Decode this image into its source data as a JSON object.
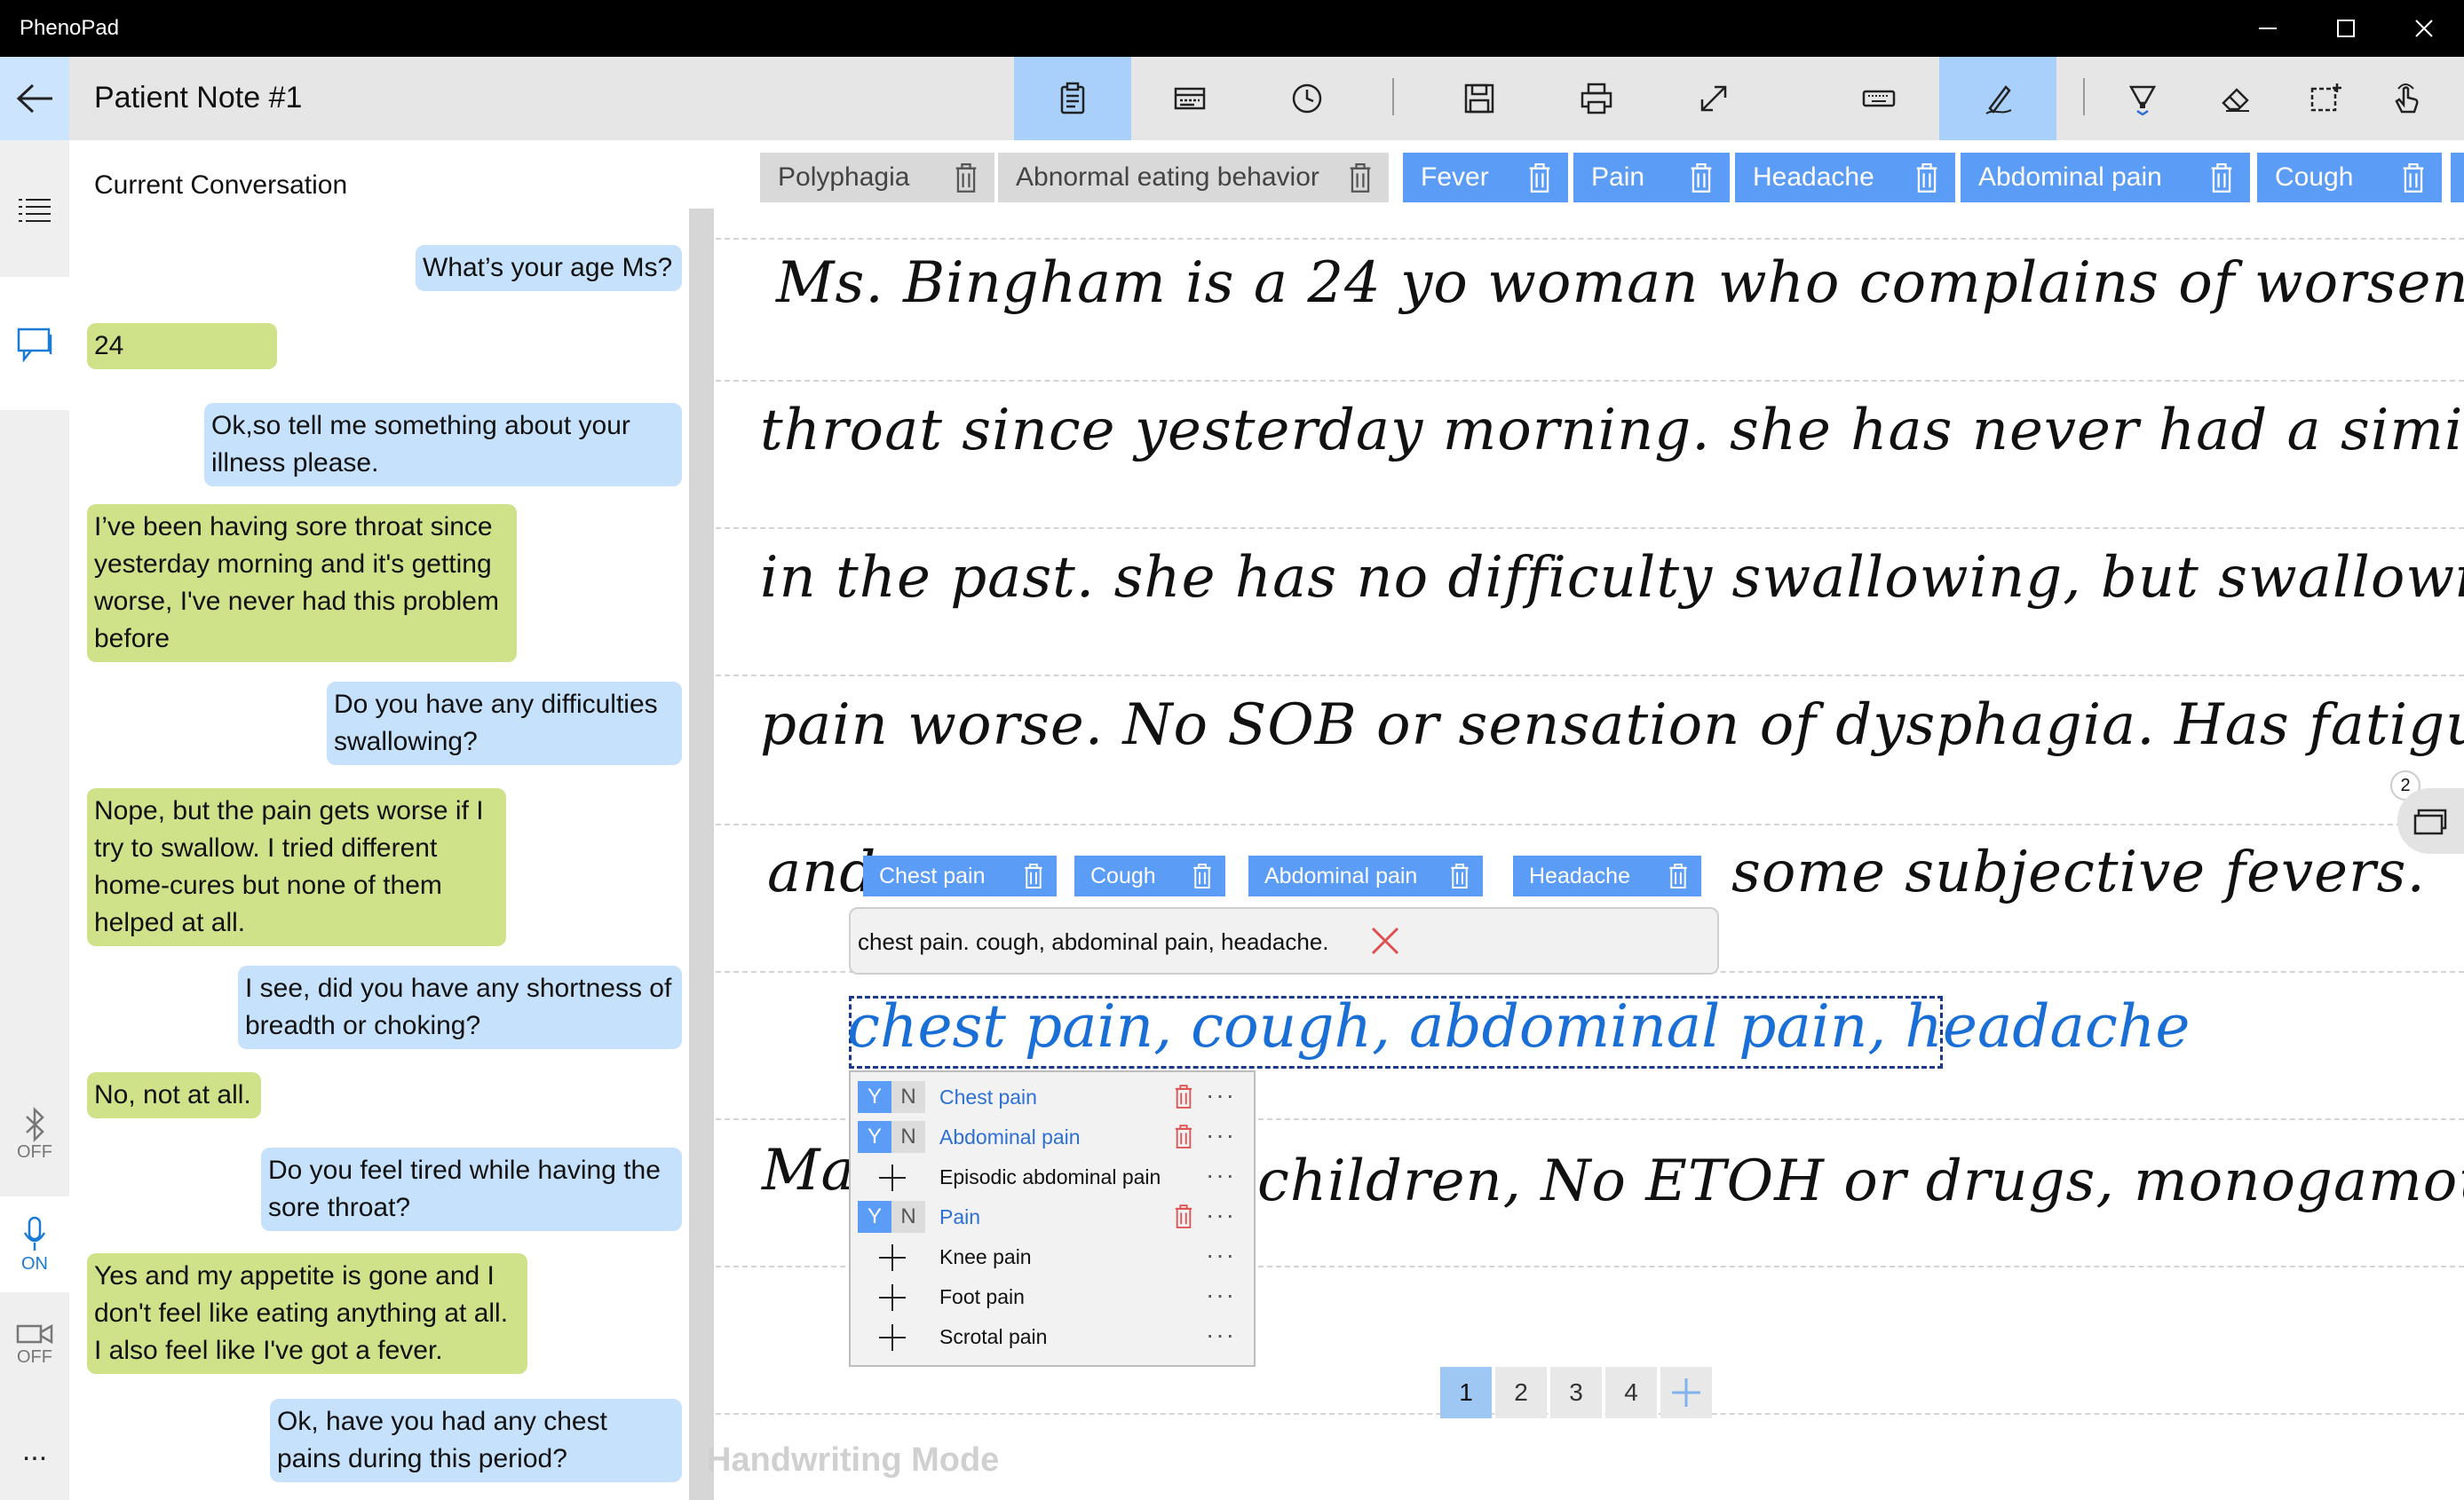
{
  "app": {
    "title": "PhenoPad"
  },
  "header": {
    "note_title": "Patient Note #1"
  },
  "conversation": {
    "title": "Current Conversation",
    "messages": [
      {
        "speaker": "doctor",
        "text": "What’s your age Ms?"
      },
      {
        "speaker": "patient",
        "text": "24"
      },
      {
        "speaker": "doctor",
        "text": "Ok,so tell me something about your illness please."
      },
      {
        "speaker": "patient",
        "text": "I’ve been having sore throat since yesterday morning and it's getting worse, I've never had this problem before"
      },
      {
        "speaker": "doctor",
        "text": "Do you have any difficulties swallowing?"
      },
      {
        "speaker": "patient",
        "text": "Nope, but the pain gets worse if I try to swallow. I tried different home-cures but none of them helped at all."
      },
      {
        "speaker": "doctor",
        "text": "I see, did you have any shortness of breadth or choking?"
      },
      {
        "speaker": "patient",
        "text": "No, not at all."
      },
      {
        "speaker": "doctor",
        "text": "Do you feel tired while having the sore throat?"
      },
      {
        "speaker": "patient",
        "text": "Yes and my appetite is gone and I don't feel like eating anything at all. I also feel like I've got a fever."
      },
      {
        "speaker": "doctor",
        "text": "Ok, have you had any chest pains during this period?"
      }
    ]
  },
  "rail": {
    "bluetooth_label": "OFF",
    "mic_label": "ON",
    "camera_label": "OFF",
    "more_label": "..."
  },
  "phenotype_tags": [
    {
      "label": "Polyphagia",
      "state": "inactive"
    },
    {
      "label": "Abnormal eating behavior",
      "state": "inactive"
    },
    {
      "label": "Fever",
      "state": "active"
    },
    {
      "label": "Pain",
      "state": "active"
    },
    {
      "label": "Headache",
      "state": "active"
    },
    {
      "label": "Abdominal pain",
      "state": "active"
    },
    {
      "label": "Cough",
      "state": "active"
    }
  ],
  "handwriting": {
    "lines": [
      "Ms. Bingham is a 24 yo woman who complains of worsening sore",
      "throat since yesterday morning. she has never had a similar problem",
      "in the past. she has no difficulty swallowing, but swallowing makes",
      "pain worse. No SOB or sensation of dysphagia. Has fatigue and Sor",
      "and",
      "some subjective fevers.",
      "Ma",
      "children, No ETOH or drugs, monogamous with hus"
    ],
    "selected_text": "chest pain, cough, abdominal pain, headache"
  },
  "inline_tags": [
    "Chest pain",
    "Cough",
    "Abdominal pain",
    "Headache"
  ],
  "recognition": {
    "text": "chest pain. cough, abdominal pain, headache."
  },
  "suggestions": [
    {
      "label": "Chest pain",
      "selected": true
    },
    {
      "label": "Abdominal pain",
      "selected": true
    },
    {
      "label": "Episodic abdominal pain",
      "selected": false
    },
    {
      "label": "Pain",
      "selected": true
    },
    {
      "label": "Knee pain",
      "selected": false
    },
    {
      "label": "Foot pain",
      "selected": false
    },
    {
      "label": "Scrotal pain",
      "selected": false
    }
  ],
  "suggestion_controls": {
    "yes": "Y",
    "no": "N",
    "more": "···"
  },
  "pages": [
    "1",
    "2",
    "3",
    "4"
  ],
  "current_page": "1",
  "side_panel": {
    "count": "2"
  },
  "mode_label": "Handwriting Mode",
  "colors": {
    "accent": "#5b9cf6",
    "doctor_bubble": "#c6e1fc",
    "patient_bubble": "#cfe28a",
    "toolbar_active": "#a9d0fb",
    "selection_ink": "#1a6fd6",
    "delete_red": "#e05050"
  },
  "icons": {
    "title_bar": [
      "minimize-icon",
      "maximize-icon",
      "close-icon"
    ],
    "toolbar": [
      "clipboard-icon",
      "keyboard-tray-icon",
      "clock-icon",
      "save-icon",
      "print-icon",
      "expand-icon",
      "keyboard-icon",
      "pen-icon",
      "highlighter-icon",
      "eraser-icon",
      "lasso-select-icon",
      "touch-icon"
    ]
  }
}
